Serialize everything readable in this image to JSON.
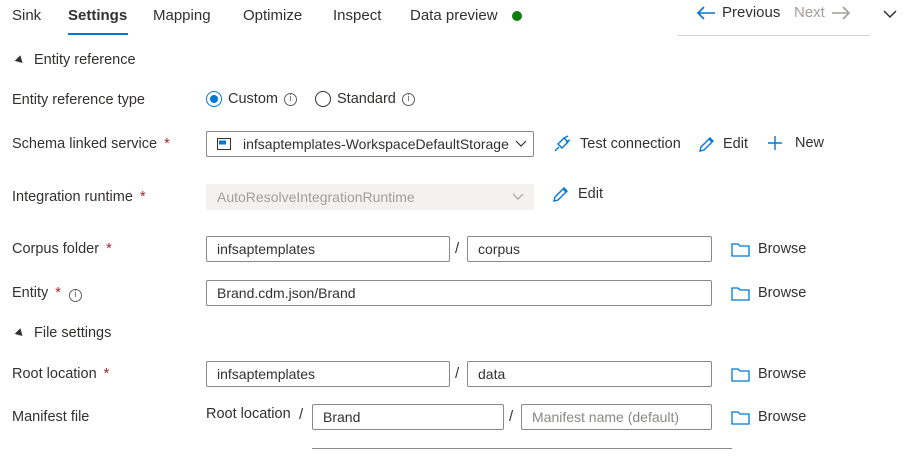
{
  "tabs": [
    {
      "label": "Sink"
    },
    {
      "label": "Settings"
    },
    {
      "label": "Mapping"
    },
    {
      "label": "Optimize"
    },
    {
      "label": "Inspect"
    },
    {
      "label": "Data preview"
    }
  ],
  "active_tab": "Settings",
  "status_color": "#107c10",
  "nav": {
    "previous": "Previous",
    "next": "Next"
  },
  "sections": {
    "entity_reference": "Entity reference",
    "file_settings": "File settings"
  },
  "entity_reference_type": {
    "label": "Entity reference type",
    "options": [
      {
        "label": "Custom"
      },
      {
        "label": "Standard"
      }
    ],
    "selected": "Custom"
  },
  "schema_linked_service": {
    "label": "Schema linked service",
    "required": "*",
    "value": "infsaptemplates-WorkspaceDefaultStorage",
    "test_connection": "Test connection",
    "edit": "Edit",
    "new": "New"
  },
  "integration_runtime": {
    "label": "Integration runtime",
    "required": "*",
    "value": "AutoResolveIntegrationRuntime",
    "edit": "Edit"
  },
  "corpus_folder": {
    "label": "Corpus folder",
    "required": "*",
    "container": "infsaptemplates",
    "path": "corpus",
    "browse": "Browse"
  },
  "entity": {
    "label": "Entity",
    "required": "*",
    "value": "Brand.cdm.json/Brand",
    "browse": "Browse"
  },
  "root_location": {
    "label": "Root location",
    "required": "*",
    "container": "infsaptemplates",
    "path": "data",
    "browse": "Browse"
  },
  "manifest_file": {
    "label": "Manifest file",
    "sub_label": "Root location",
    "value": "Brand",
    "name_placeholder": "Manifest name (default)",
    "browse": "Browse"
  },
  "separator": "/",
  "colors": {
    "accent": "#0078d4",
    "required": "#a4262c",
    "status": "#107c10"
  }
}
